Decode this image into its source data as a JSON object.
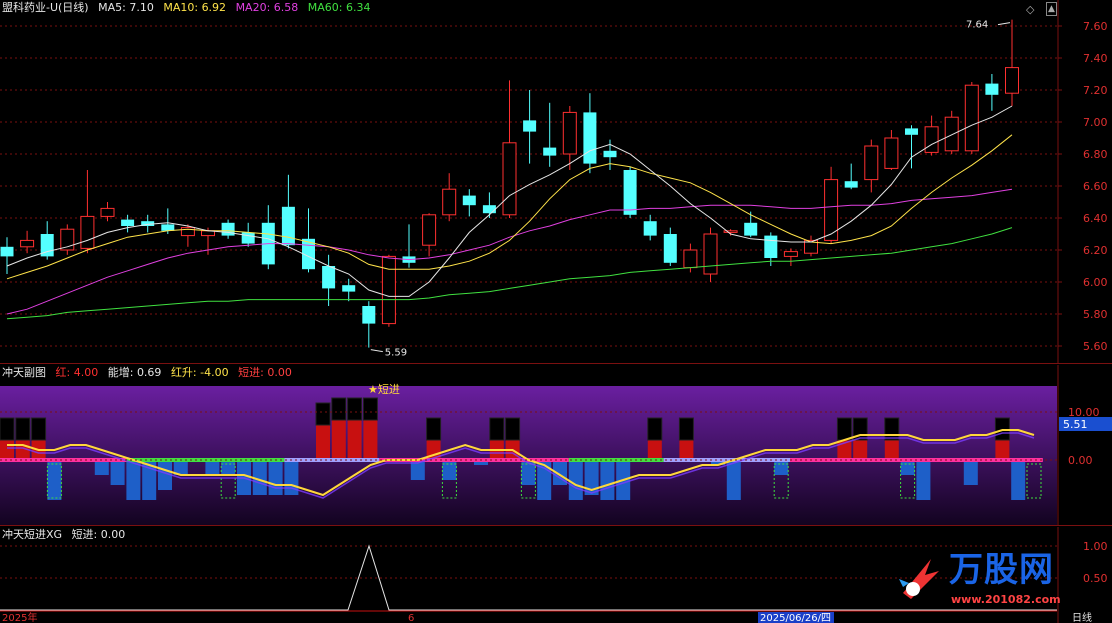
{
  "main": {
    "title": "盟科药业-U(日线)",
    "ma": [
      {
        "label": "MA5:",
        "value": "7.10",
        "color": "#e6e6e6"
      },
      {
        "label": "MA10:",
        "value": "6.92",
        "color": "#ffe34a"
      },
      {
        "label": "MA20:",
        "value": "6.58",
        "color": "#e040e0"
      },
      {
        "label": "MA60:",
        "value": "6.34",
        "color": "#40e040"
      }
    ],
    "yticks": [
      "7.60",
      "7.40",
      "7.20",
      "7.00",
      "6.80",
      "6.60",
      "6.40",
      "6.20",
      "6.00",
      "5.80",
      "5.60"
    ],
    "high_label": "7.64",
    "low_label": "5.59",
    "candles": [
      [
        6.22,
        6.16,
        6.28,
        6.05
      ],
      [
        6.22,
        6.26,
        6.32,
        6.18
      ],
      [
        6.3,
        6.16,
        6.38,
        6.14
      ],
      [
        6.2,
        6.33,
        6.36,
        6.17
      ],
      [
        6.21,
        6.41,
        6.7,
        6.18
      ],
      [
        6.41,
        6.46,
        6.5,
        6.38
      ],
      [
        6.39,
        6.35,
        6.42,
        6.31
      ],
      [
        6.38,
        6.35,
        6.42,
        6.31
      ],
      [
        6.36,
        6.32,
        6.46,
        6.3
      ],
      [
        6.29,
        6.34,
        6.36,
        6.22
      ],
      [
        6.29,
        6.32,
        6.34,
        6.17
      ],
      [
        6.37,
        6.29,
        6.39,
        6.27
      ],
      [
        6.31,
        6.24,
        6.37,
        6.22
      ],
      [
        6.37,
        6.11,
        6.48,
        6.08
      ],
      [
        6.47,
        6.23,
        6.67,
        6.21
      ],
      [
        6.27,
        6.08,
        6.46,
        6.06
      ],
      [
        6.1,
        5.96,
        6.17,
        5.85
      ],
      [
        5.98,
        5.94,
        6.02,
        5.88
      ],
      [
        5.85,
        5.74,
        5.88,
        5.59
      ],
      [
        5.74,
        6.16,
        6.17,
        5.72
      ],
      [
        6.16,
        6.12,
        6.36,
        6.09
      ],
      [
        6.23,
        6.42,
        6.43,
        6.16
      ],
      [
        6.42,
        6.58,
        6.68,
        6.38
      ],
      [
        6.54,
        6.48,
        6.58,
        6.41
      ],
      [
        6.48,
        6.43,
        6.56,
        6.4
      ],
      [
        6.42,
        6.87,
        7.26,
        6.4
      ],
      [
        7.01,
        6.94,
        7.2,
        6.74
      ],
      [
        6.84,
        6.79,
        7.12,
        6.72
      ],
      [
        6.8,
        7.06,
        7.1,
        6.7
      ],
      [
        7.06,
        6.74,
        7.18,
        6.68
      ],
      [
        6.82,
        6.78,
        6.89,
        6.7
      ],
      [
        6.7,
        6.42,
        6.72,
        6.4
      ],
      [
        6.38,
        6.29,
        6.42,
        6.26
      ],
      [
        6.3,
        6.12,
        6.34,
        6.1
      ],
      [
        6.09,
        6.2,
        6.24,
        6.06
      ],
      [
        6.05,
        6.3,
        6.34,
        6.0
      ],
      [
        6.31,
        6.32,
        6.33,
        6.29
      ],
      [
        6.37,
        6.29,
        6.44,
        6.28
      ],
      [
        6.29,
        6.15,
        6.31,
        6.1
      ],
      [
        6.16,
        6.19,
        6.21,
        6.1
      ],
      [
        6.18,
        6.26,
        6.29,
        6.16
      ],
      [
        6.26,
        6.64,
        6.72,
        6.24
      ],
      [
        6.63,
        6.59,
        6.74,
        6.58
      ],
      [
        6.64,
        6.85,
        6.89,
        6.56
      ],
      [
        6.71,
        6.9,
        6.95,
        6.7
      ],
      [
        6.96,
        6.92,
        6.98,
        6.71
      ],
      [
        6.81,
        6.97,
        7.04,
        6.79
      ],
      [
        6.82,
        7.03,
        7.07,
        6.8
      ],
      [
        6.82,
        7.23,
        7.25,
        6.8
      ],
      [
        7.24,
        7.17,
        7.3,
        7.07
      ],
      [
        7.18,
        7.34,
        7.64,
        7.1
      ]
    ],
    "ma5": [
      6.1,
      6.15,
      6.19,
      6.22,
      6.26,
      6.31,
      6.34,
      6.36,
      6.37,
      6.35,
      6.32,
      6.31,
      6.29,
      6.27,
      6.22,
      6.16,
      6.1,
      6.05,
      5.95,
      5.91,
      5.91,
      6.0,
      6.15,
      6.31,
      6.42,
      6.54,
      6.61,
      6.67,
      6.74,
      6.82,
      6.86,
      6.8,
      6.7,
      6.6,
      6.49,
      6.4,
      6.3,
      6.27,
      6.26,
      6.25,
      6.25,
      6.3,
      6.38,
      6.48,
      6.61,
      6.78,
      6.86,
      6.92,
      6.98,
      7.03,
      7.1
    ],
    "ma10": [
      6.02,
      6.06,
      6.1,
      6.15,
      6.2,
      6.24,
      6.28,
      6.3,
      6.32,
      6.33,
      6.32,
      6.32,
      6.31,
      6.3,
      6.28,
      6.25,
      6.22,
      6.18,
      6.11,
      6.08,
      6.08,
      6.08,
      6.1,
      6.13,
      6.18,
      6.26,
      6.38,
      6.52,
      6.64,
      6.71,
      6.74,
      6.72,
      6.68,
      6.65,
      6.62,
      6.56,
      6.49,
      6.42,
      6.36,
      6.3,
      6.25,
      6.24,
      6.26,
      6.29,
      6.35,
      6.46,
      6.56,
      6.65,
      6.73,
      6.82,
      6.92
    ],
    "ma20": [
      5.8,
      5.83,
      5.88,
      5.93,
      5.98,
      6.03,
      6.07,
      6.11,
      6.15,
      6.18,
      6.2,
      6.22,
      6.23,
      6.24,
      6.24,
      6.23,
      6.22,
      6.2,
      6.17,
      6.15,
      6.14,
      6.15,
      6.17,
      6.2,
      6.23,
      6.28,
      6.32,
      6.35,
      6.39,
      6.42,
      6.45,
      6.45,
      6.46,
      6.46,
      6.47,
      6.48,
      6.48,
      6.48,
      6.47,
      6.46,
      6.46,
      6.47,
      6.48,
      6.48,
      6.49,
      6.51,
      6.52,
      6.53,
      6.54,
      6.56,
      6.58
    ],
    "ma60": [
      5.77,
      5.78,
      5.79,
      5.81,
      5.82,
      5.83,
      5.84,
      5.85,
      5.86,
      5.87,
      5.88,
      5.88,
      5.89,
      5.89,
      5.89,
      5.89,
      5.89,
      5.89,
      5.89,
      5.89,
      5.89,
      5.9,
      5.92,
      5.93,
      5.94,
      5.96,
      5.98,
      6.0,
      6.02,
      6.03,
      6.04,
      6.06,
      6.07,
      6.08,
      6.09,
      6.1,
      6.11,
      6.12,
      6.13,
      6.13,
      6.14,
      6.15,
      6.16,
      6.17,
      6.18,
      6.2,
      6.22,
      6.24,
      6.27,
      6.3,
      6.34
    ]
  },
  "sub1": {
    "title": "冲天副图",
    "items": [
      {
        "label": "红:",
        "value": "4.00",
        "color": "#ff3030"
      },
      {
        "label": "能增:",
        "value": "0.69",
        "color": "#e6e6e6"
      },
      {
        "label": "红升:",
        "value": "-4.00",
        "color": "#ffe34a"
      },
      {
        "label": "短进:",
        "value": "0.00",
        "color": "#ff4040"
      }
    ],
    "yticks": [
      "10.00",
      "0.00"
    ],
    "current_value": "5.51",
    "marker_text": "★短进",
    "bars": [
      4,
      4,
      4,
      -8,
      0,
      0,
      -3,
      -5,
      -8,
      -8,
      -6,
      -3,
      0,
      -3,
      -3,
      -7,
      -7,
      -7,
      -7,
      0,
      7,
      8,
      8,
      8,
      0,
      0,
      -4,
      4,
      -4,
      0,
      -1,
      4,
      4,
      -5,
      -8,
      -5,
      -8,
      -7,
      -8,
      -8,
      0,
      4,
      0,
      4,
      0,
      -1,
      -8,
      0,
      0,
      -3,
      0,
      0,
      0,
      4,
      4,
      0,
      4,
      -3,
      -8,
      0,
      0,
      -5,
      0,
      4,
      -8,
      0
    ],
    "line": [
      3,
      3,
      2,
      2,
      3,
      3,
      2,
      1,
      0,
      -1,
      -2,
      -3,
      -3,
      -3,
      -3,
      -3,
      -4,
      -5,
      -5,
      -6,
      -7,
      -5,
      -3,
      -1,
      0,
      0,
      0,
      1,
      2,
      3,
      2,
      2,
      2,
      0,
      -1,
      -3,
      -5,
      -6,
      -5,
      -4,
      -3,
      -3,
      -3,
      -2,
      -1,
      -1,
      0,
      1,
      2,
      2,
      2,
      3,
      3,
      4,
      5,
      5,
      5,
      5,
      4,
      4,
      4,
      5,
      5,
      6,
      6,
      5
    ]
  },
  "sub2": {
    "title": "冲天短进XG",
    "items": [
      {
        "label": "短进:",
        "value": "0.00",
        "color": "#e6e6e6"
      }
    ],
    "yticks": [
      "1.00",
      "0.50"
    ]
  },
  "axis": {
    "labels": [
      "2025年",
      "6",
      "2025/06/26/四",
      "日线"
    ]
  },
  "watermark": {
    "text": "万股网",
    "sub": "www.201082.com"
  },
  "colors": {
    "up": "#ff3030",
    "down": "#54ffff",
    "grid": "#7a1010"
  }
}
